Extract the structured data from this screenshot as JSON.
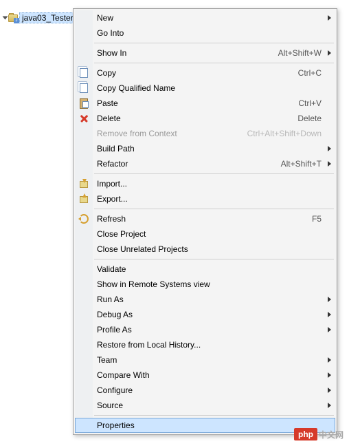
{
  "tree": {
    "selected_node": "java03_Tester"
  },
  "menu": {
    "items": [
      {
        "label": "New",
        "submenu": true
      },
      {
        "label": "Go Into"
      },
      {
        "sep": true
      },
      {
        "label": "Show In",
        "shortcut": "Alt+Shift+W",
        "submenu": true
      },
      {
        "sep": true
      },
      {
        "label": "Copy",
        "shortcut": "Ctrl+C",
        "icon": "copy"
      },
      {
        "label": "Copy Qualified Name",
        "icon": "copy"
      },
      {
        "label": "Paste",
        "shortcut": "Ctrl+V",
        "icon": "paste"
      },
      {
        "label": "Delete",
        "shortcut": "Delete",
        "icon": "delete"
      },
      {
        "label": "Remove from Context",
        "shortcut": "Ctrl+Alt+Shift+Down",
        "disabled": true
      },
      {
        "label": "Build Path",
        "submenu": true
      },
      {
        "label": "Refactor",
        "shortcut": "Alt+Shift+T",
        "submenu": true
      },
      {
        "sep": true
      },
      {
        "label": "Import...",
        "icon": "import"
      },
      {
        "label": "Export...",
        "icon": "export"
      },
      {
        "sep": true
      },
      {
        "label": "Refresh",
        "shortcut": "F5",
        "icon": "refresh"
      },
      {
        "label": "Close Project"
      },
      {
        "label": "Close Unrelated Projects"
      },
      {
        "sep": true
      },
      {
        "label": "Validate"
      },
      {
        "label": "Show in Remote Systems view"
      },
      {
        "label": "Run As",
        "submenu": true
      },
      {
        "label": "Debug As",
        "submenu": true
      },
      {
        "label": "Profile As",
        "submenu": true
      },
      {
        "label": "Restore from Local History..."
      },
      {
        "label": "Team",
        "submenu": true
      },
      {
        "label": "Compare With",
        "submenu": true
      },
      {
        "label": "Configure",
        "submenu": true
      },
      {
        "label": "Source",
        "submenu": true
      },
      {
        "sep": true
      },
      {
        "label": "Properties",
        "hover": true
      }
    ]
  },
  "watermark": {
    "logo": "php",
    "text": "中文网"
  }
}
